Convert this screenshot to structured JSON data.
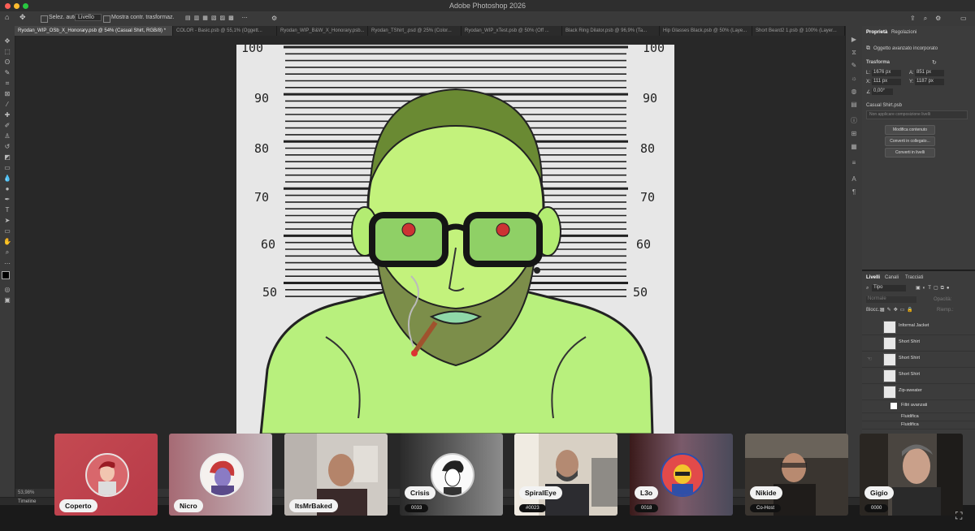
{
  "window": {
    "title": "Adobe Photoshop 2026"
  },
  "options_bar": {
    "auto_select_label": "Selez. auto:",
    "auto_select_value": "Livello",
    "transform_controls_label": "Mostra contr. trasformaz."
  },
  "tabs": [
    "Ryodan_WIP_OSb_X_Honorary.psb @ 54% (Casual Shirt, RGB/8) *",
    "COLOR - Basic.psb @ 55,1% (Oggett...",
    "Ryodan_WIP_B&W_X_Honorary.psb...",
    "Ryodan_TShirt_.psd @ 25% (Color...",
    "Ryodan_WIP_xTest.psb @ 50% (Off ...",
    "Black Ring Dilator.psb @ 96,9% (Ta...",
    "Hip Glasses Black.psb @ 50% (Laye...",
    "Short Beard2 1.psb @ 100% (Layer..."
  ],
  "artwork": {
    "height_marks": [
      "100",
      "90",
      "80",
      "70",
      "60",
      "50"
    ]
  },
  "properties": {
    "tab_properties": "Proprietà",
    "tab_adjustments": "Regolazioni",
    "object_type": "Oggetto avanzato incorporato",
    "transform_heading": "Trasforma",
    "w_label": "L:",
    "w_value": "1676 px",
    "h_label": "A:",
    "h_value": "851 px",
    "x_label": "X:",
    "x_value": "111 px",
    "y_label": "Y:",
    "y_value": "1187 px",
    "angle_value": "0,00°",
    "linked_file": "Casual Shirt.psb",
    "comp_placeholder": "Non applicare composizione livelli",
    "buttons": [
      "Modifica contenuto",
      "Converti in collegato...",
      "Converti in livelli"
    ]
  },
  "layers_panel": {
    "tab_layers": "Livelli",
    "tab_channels": "Canali",
    "tab_paths": "Tracciati",
    "filter_kind": "Tipo",
    "blend_mode": "Normale",
    "opacity_label": "Opacità:",
    "lock_label": "Blocc.:",
    "fill_label": "Riemp.:",
    "layers": [
      {
        "name": "Informal Jacket"
      },
      {
        "name": "Short Shirt"
      },
      {
        "name": "Short Shirt"
      },
      {
        "name": "Short Shirt"
      },
      {
        "name": "Zip-sweater"
      }
    ],
    "smart_filters_label": "Filtri avanzati",
    "filters": [
      "Fluidifica",
      "Fluidifica"
    ]
  },
  "status": {
    "zoom": "53,98%",
    "timeline_label": "Timeline"
  },
  "participants": [
    {
      "name": "Coperto",
      "sub": ""
    },
    {
      "name": "Nicro",
      "sub": ""
    },
    {
      "name": "ItsMrBaked",
      "sub": ""
    },
    {
      "name": "Crisis",
      "sub": "0033"
    },
    {
      "name": "SpiralEye",
      "sub": "#0023"
    },
    {
      "name": "L3o",
      "sub": "0018"
    },
    {
      "name": "Nikide",
      "sub": "Co-Host"
    },
    {
      "name": "Gigio",
      "sub": "0000"
    }
  ]
}
